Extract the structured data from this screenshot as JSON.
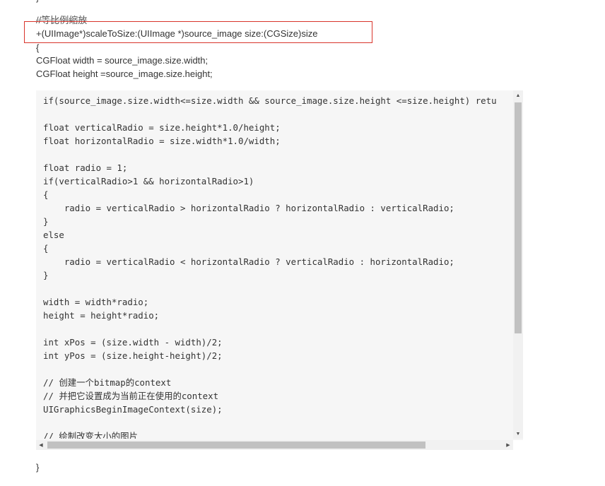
{
  "article": {
    "top_brace": "}",
    "comment": "//等比例缩放",
    "signature": "+(UIImage*)scaleToSize:(UIImage *)source_image size:(CGSize)size",
    "open_brace": "{",
    "width_decl": "CGFloat width = source_image.size.width;",
    "height_decl": "CGFloat height =source_image.size.height;",
    "close_brace": "}"
  },
  "code_block": {
    "lines": [
      "if(source_image.size.width<=size.width && source_image.size.height <=size.height) retu",
      "",
      "float verticalRadio = size.height*1.0/height;",
      "float horizontalRadio = size.width*1.0/width;",
      "",
      "float radio = 1;",
      "if(verticalRadio>1 && horizontalRadio>1)",
      "{",
      "    radio = verticalRadio > horizontalRadio ? horizontalRadio : verticalRadio;",
      "}",
      "else",
      "{",
      "    radio = verticalRadio < horizontalRadio ? verticalRadio : horizontalRadio;",
      "}",
      "",
      "width = width*radio;",
      "height = height*radio;",
      "",
      "int xPos = (size.width - width)/2;",
      "int yPos = (size.height-height)/2;",
      "",
      "// 创建一个bitmap的context",
      "// 并把它设置成为当前正在使用的context",
      "UIGraphicsBeginImageContext(size);",
      "",
      "// 绘制改变大小的图片"
    ],
    "scroll_up_icon": "▲",
    "scroll_down_icon": "▼",
    "scroll_left_icon": "◀",
    "scroll_right_icon": "▶"
  },
  "colors": {
    "highlight_border": "#d9342b",
    "code_background": "#f6f6f6",
    "scroll_thumb": "#c1c1c1"
  }
}
